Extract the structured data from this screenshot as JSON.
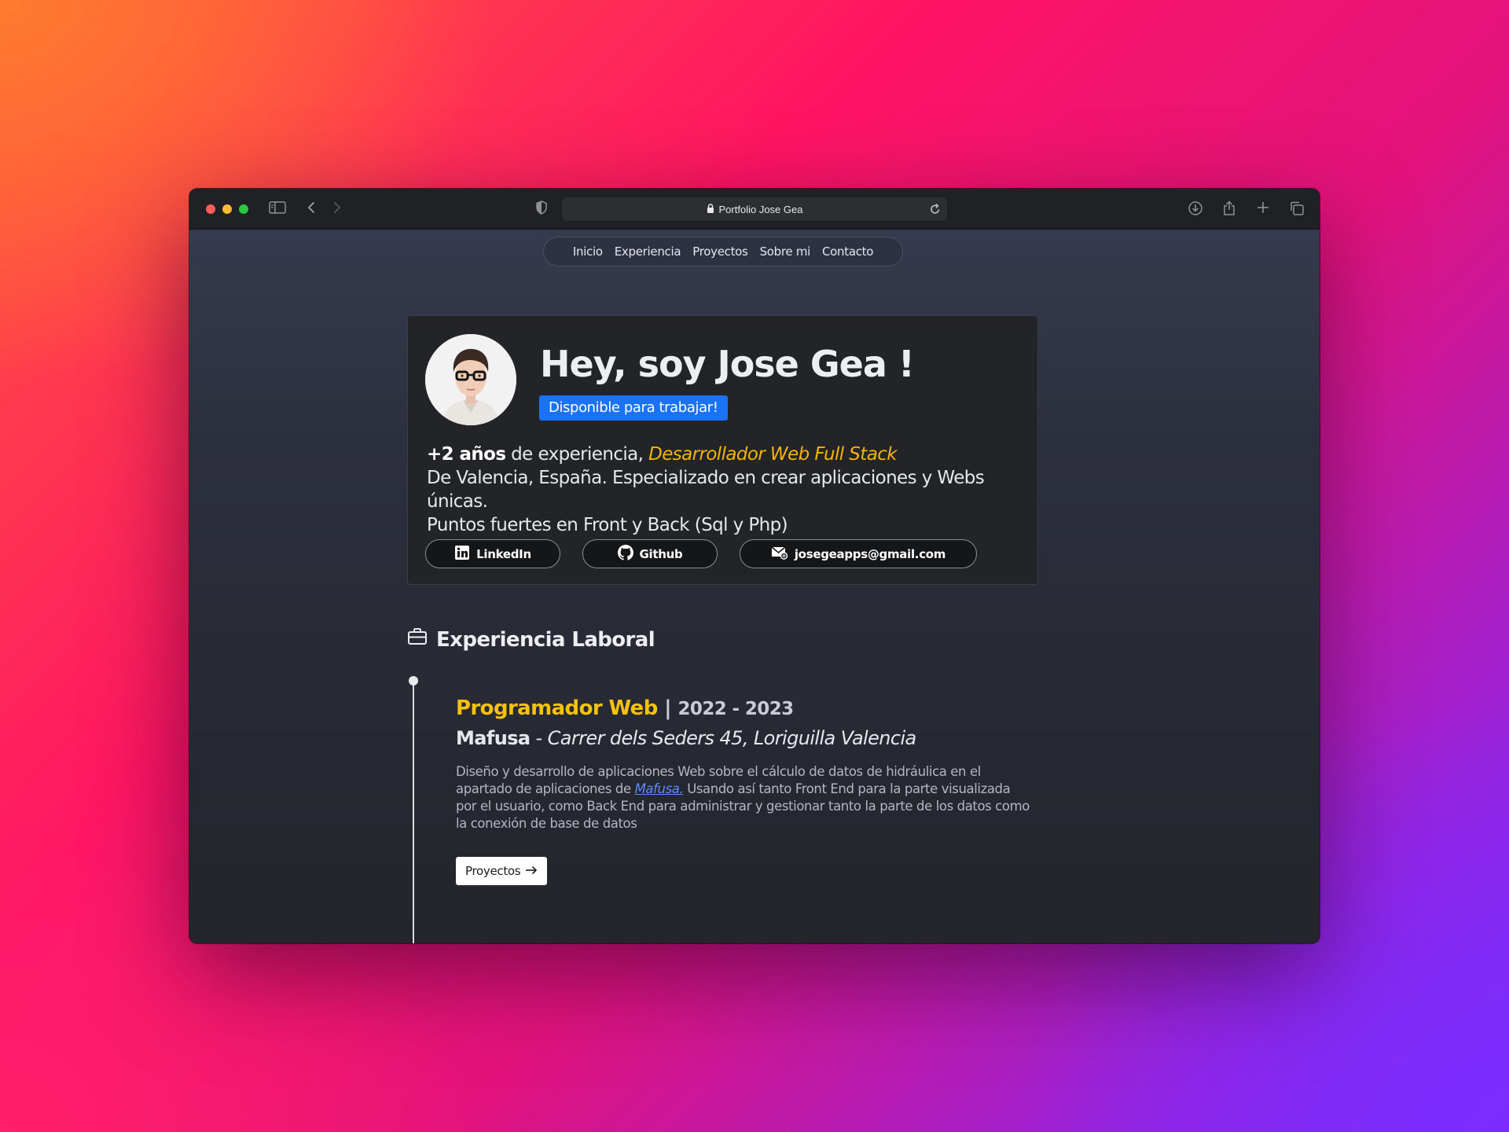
{
  "browser": {
    "url_title": "Portfolio Jose Gea"
  },
  "nav": {
    "items": [
      "Inicio",
      "Experiencia",
      "Proyectos",
      "Sobre mi",
      "Contacto"
    ]
  },
  "hero": {
    "title": "Hey, soy Jose Gea !",
    "badge": "Disponible para trabajar!",
    "years": "+2 años",
    "exp_text": " de experiencia, ",
    "role": "Desarrollador Web Full Stack",
    "line2": "De Valencia, España. Especializado en crear aplicaciones y Webs únicas.",
    "line3": "Puntos fuertes en Front y Back (Sql y Php)",
    "buttons": {
      "linkedin": "LinkedIn",
      "github": "Github",
      "email": "josegeapps@gmail.com"
    }
  },
  "experience": {
    "section_title": "Experiencia Laboral",
    "job": {
      "role": "Programador Web",
      "separator": " | ",
      "years": "2022 - 2023",
      "company": "Mafusa",
      "dash": " - ",
      "address": "Carrer dels Seders 45, Loriguilla Valencia",
      "desc_1": "Diseño y desarrollo de aplicaciones Web sobre el cálculo de datos de hidráulica en el apartado de aplicaciones de ",
      "desc_link": "Mafusa.",
      "desc_2": " Usando así tanto Front End para la parte visualizada por el usuario, como Back End para administrar y gestionar tanto la parte de los datos como la conexión de base de datos",
      "button": "Proyectos"
    }
  }
}
